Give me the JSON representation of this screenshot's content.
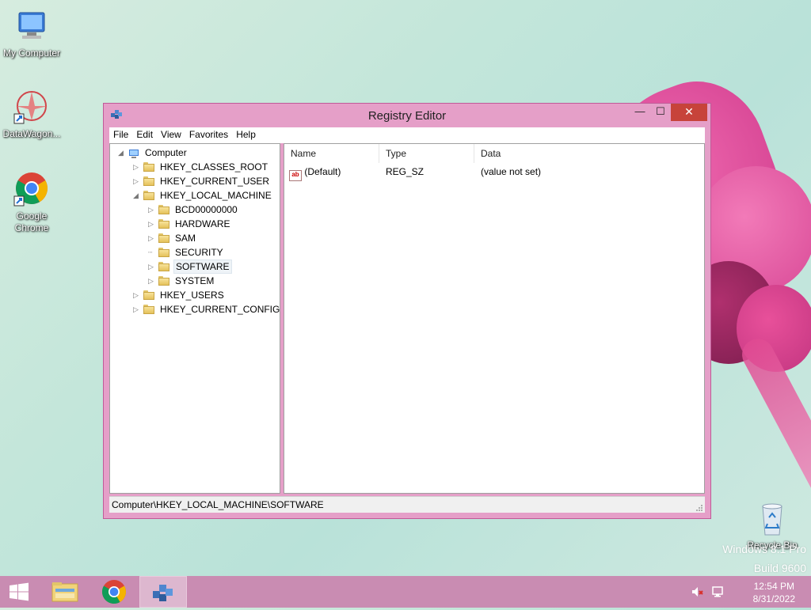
{
  "desktop": {
    "icons": [
      {
        "label": "My Computer"
      },
      {
        "label": "DataWagon..."
      },
      {
        "label": "Google Chrome"
      },
      {
        "label": "Recycle Bin"
      }
    ],
    "watermark_line1": "Windows 8.1 Pro",
    "watermark_line2": "Build 9600"
  },
  "window": {
    "title": "Registry Editor",
    "min_glyph": "—",
    "max_glyph": "☐",
    "close_glyph": "✕",
    "menu": [
      "File",
      "Edit",
      "View",
      "Favorites",
      "Help"
    ],
    "tree": {
      "root": "Computer",
      "hives": [
        {
          "label": "HKEY_CLASSES_ROOT"
        },
        {
          "label": "HKEY_CURRENT_USER"
        },
        {
          "label": "HKEY_LOCAL_MACHINE"
        },
        {
          "label": "HKEY_USERS"
        },
        {
          "label": "HKEY_CURRENT_CONFIG"
        }
      ],
      "hklm_children": [
        {
          "label": "BCD00000000"
        },
        {
          "label": "HARDWARE"
        },
        {
          "label": "SAM"
        },
        {
          "label": "SECURITY"
        },
        {
          "label": "SOFTWARE"
        },
        {
          "label": "SYSTEM"
        }
      ],
      "selected": "SOFTWARE"
    },
    "list": {
      "columns": [
        "Name",
        "Type",
        "Data"
      ],
      "rows": [
        {
          "name": "(Default)",
          "type": "REG_SZ",
          "data": "(value not set)",
          "icon": "ab"
        }
      ]
    },
    "status": "Computer\\HKEY_LOCAL_MACHINE\\SOFTWARE"
  },
  "taskbar": {
    "time": "12:54 PM",
    "date": "8/31/2022",
    "items": [
      "start-button",
      "file-explorer",
      "google-chrome",
      "registry-editor"
    ]
  },
  "colors": {
    "window_frame": "#e59fc8",
    "taskbar": "#c98cb2",
    "close_button": "#c7433a"
  }
}
